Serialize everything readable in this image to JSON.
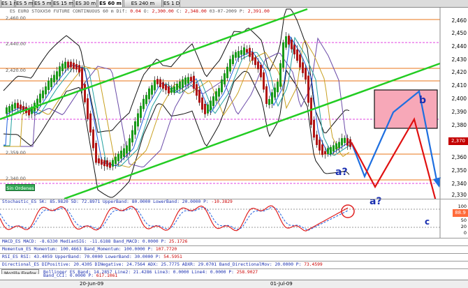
{
  "tabs": [
    {
      "label": "ES 1 m",
      "active": false
    },
    {
      "label": "ES 5 m",
      "active": false
    },
    {
      "label": "ES 5 m",
      "active": false
    },
    {
      "label": "ES 15 m",
      "active": false
    },
    {
      "label": "ES 30 m",
      "active": false
    },
    {
      "label": "ES 60 m",
      "active": true
    },
    {
      "label": "ES 240 m",
      "active": false
    },
    {
      "label": "ES 1 D",
      "active": false
    }
  ],
  "price_info": {
    "symbol": "ES EURO STOXX50 FUTURE CONTINUOUS",
    "tf": "60 m Dif: ",
    "dif": "0.04",
    "open_lbl": "O: ",
    "open": "2,300.00",
    "close_lbl": "C: ",
    "close": "2,348.00",
    "date": "03-07-2009",
    "last_lbl": "P: ",
    "last": "2,391.00"
  },
  "y_labels_right": [
    "2,460",
    "2,450",
    "2,440",
    "2,430",
    "2,420",
    "2,410",
    "2,400",
    "2,390",
    "2,380",
    "2,370",
    "2,360",
    "2,350",
    "2,340",
    "2,330"
  ],
  "y_labels_left": [
    "2,460.00",
    "2,440.00",
    "2,420.00",
    "2,359.00",
    "2,340.00"
  ],
  "current_price": "2,370",
  "sin_ordenes": "Sin Ordenes",
  "scenario_labels": {
    "a1": "a?",
    "a2": "a?",
    "b": "b",
    "c": "c"
  },
  "stochastic": {
    "title": "Stochastic_ES 5K: 85.9820 5D: 72.8971 UpperBand: 80.0000 LowerBand: 20.0000 P: ",
    "value": "-10.3829",
    "box": "88.9",
    "y_labels": [
      "100",
      "80",
      "50",
      "20",
      "0"
    ]
  },
  "indicators": [
    {
      "title": "MACD_ES MACD: -8.6330 MedianSIG: -11.6188 Band_MACD: 0.0000 P: ",
      "value": "25.1726"
    },
    {
      "title": "Momentum_ES Momentum: 100.4663 Band_Momentum: 100.0000 P: ",
      "value": "107.7720"
    },
    {
      "title": "RSI_ES RSI: 43.4059 UpperBand: 70.0000 LowerBand: 30.0000 P: ",
      "value": "54.5951"
    },
    {
      "title": "Directional_ES DIPositive: 20.4305 DINegative: 24.7564 ADX: 25.7775 ADXR: 29.0701 Band_DirectionalMov: 20.0000 P: ",
      "value": "73.4599"
    },
    {
      "title": "Bollinger_ES Band: 14.2857 Line2: 21.4286 Line3: 0.0000 Line4: 0.0000 P: ",
      "value": "258.9027"
    },
    {
      "title": "Band_CCI: 0.0000 P: ",
      "value": "617.1061"
    }
  ],
  "taskbar": {
    "label": "Mozilla Firefox"
  },
  "dates": [
    "20-Jun-09",
    "01-Jul-09"
  ],
  "colors": {
    "channel": "#22cc22",
    "bollinger": "#111111",
    "up_candle": "#1a9a1a",
    "down_candle": "#b01515",
    "scenario_blue": "#1e6fe0",
    "scenario_red": "#e01010",
    "target_box": "#f7a8b8"
  }
}
